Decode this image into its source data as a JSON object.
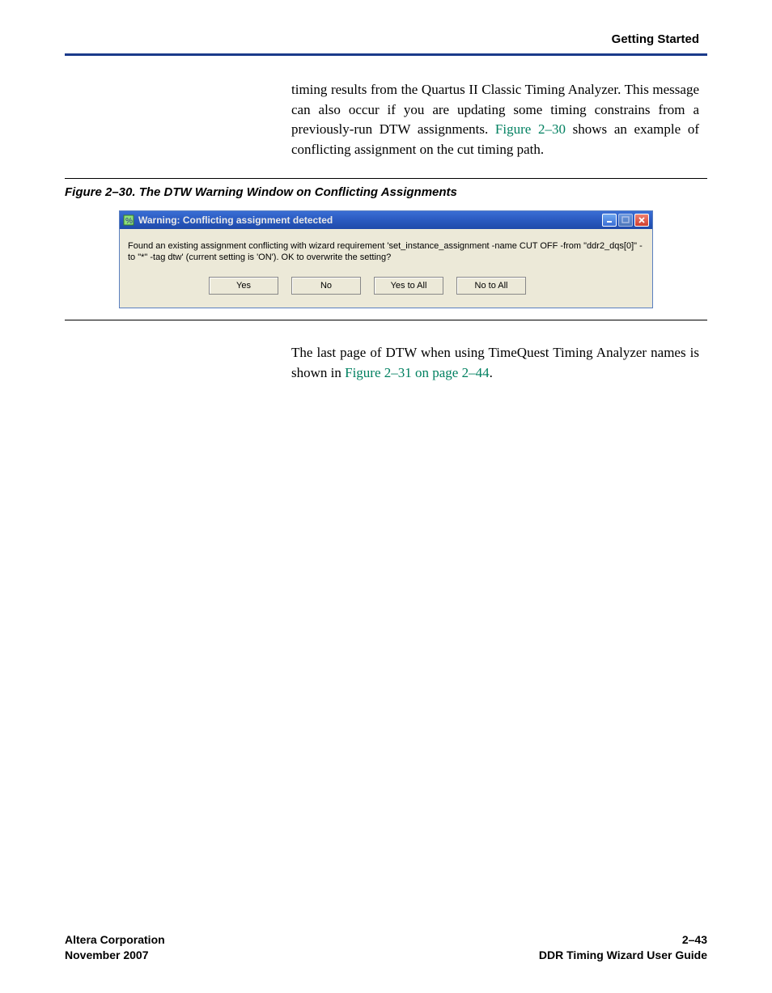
{
  "header": {
    "section": "Getting Started"
  },
  "para1": {
    "pre": "timing results from the Quartus II Classic Timing Analyzer. This message can also occur if you are updating some timing constrains from a previously-run DTW assignments. ",
    "link": "Figure 2–30",
    "post": " shows an example of conflicting assignment on the cut timing path."
  },
  "figure": {
    "caption": "Figure 2–30. The DTW Warning Window on Conflicting Assignments"
  },
  "dialog": {
    "title": "Warning: Conflicting assignment detected",
    "message": "Found an existing assignment conflicting with wizard requirement 'set_instance_assignment -name CUT OFF -from \"ddr2_dqs[0]\" -to \"*\" -tag dtw' (current setting is 'ON').  OK to overwrite the setting?",
    "buttons": {
      "yes": "Yes",
      "no": "No",
      "yesall": "Yes to All",
      "noall": "No to All"
    },
    "icons": {
      "min": "minimize-icon",
      "max": "maximize-icon",
      "close": "close-icon",
      "app": "app-icon"
    }
  },
  "para2": {
    "pre": "The last page of DTW when using TimeQuest Timing Analyzer names is shown in ",
    "link": "Figure 2–31 on page 2–44",
    "post": "."
  },
  "footer": {
    "left1": "Altera Corporation",
    "left2": "November 2007",
    "right1": "2–43",
    "right2": "DDR Timing Wizard User Guide"
  }
}
